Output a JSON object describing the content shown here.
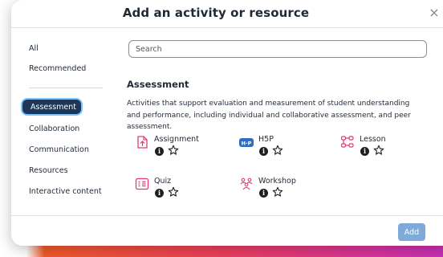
{
  "modal": {
    "title": "Add an activity or resource",
    "close_symbol": "×"
  },
  "sidebar": {
    "items": [
      {
        "label": "All"
      },
      {
        "label": "Recommended"
      },
      {
        "label": "Assessment"
      },
      {
        "label": "Collaboration"
      },
      {
        "label": "Communication"
      },
      {
        "label": "Resources"
      },
      {
        "label": "Interactive content"
      }
    ],
    "active_item": "Assessment"
  },
  "search": {
    "placeholder": "Search",
    "value": ""
  },
  "section": {
    "title": "Assessment",
    "description": "Activities that support evaluation and measurement of student understanding and performance, including individual and collaborative assessment, and peer assessment."
  },
  "activities": [
    {
      "name": "Assignment",
      "icon": "assignment-icon",
      "info": "i",
      "starred": false
    },
    {
      "name": "H5P",
      "icon": "h5p-icon",
      "icon_text": "H·P",
      "info": "i",
      "starred": false
    },
    {
      "name": "Lesson",
      "icon": "lesson-icon",
      "info": "i",
      "starred": false
    },
    {
      "name": "Quiz",
      "icon": "quiz-icon",
      "info": "i",
      "starred": false
    },
    {
      "name": "Workshop",
      "icon": "workshop-icon",
      "info": "i",
      "starred": false
    }
  ],
  "footer": {
    "add_label": "Add"
  },
  "colors": {
    "active_bg": "#1c3757",
    "active_border": "#7ec3ff",
    "icon_pink": "#e8386e",
    "h5p_blue": "#2e6fc0",
    "add_button": "#7ea9d8"
  }
}
